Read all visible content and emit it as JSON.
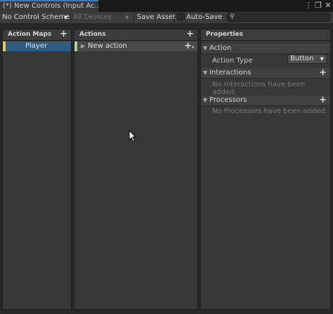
{
  "window": {
    "tab_title": "(*) New Controls (Input Ac...",
    "controls": {
      "menu": "⋮",
      "maximize": "❐",
      "close": "✕"
    }
  },
  "toolbar": {
    "control_scheme": "No Control Scheme",
    "devices": "All Devices",
    "save_asset": "Save Asset",
    "auto_save": "Auto-Save",
    "auto_save_checked": false,
    "search_value": ""
  },
  "action_maps": {
    "header": "Action Maps",
    "items": [
      {
        "label": "Player",
        "selected": true
      }
    ]
  },
  "actions": {
    "header": "Actions",
    "items": [
      {
        "label": "New action"
      }
    ]
  },
  "properties": {
    "header": "Properties",
    "action_section": "Action",
    "action_type_label": "Action Type",
    "action_type_value": "Button",
    "interactions_section": "Interactions",
    "interactions_empty": "No Interactions have been added.",
    "processors_section": "Processors",
    "processors_empty": "No Processors have been added."
  },
  "colors": {
    "accent_tab": "#3a79bb",
    "selection": "#2c5d87",
    "map_marker": "#e5c76b",
    "action_marker": "#a6d990"
  }
}
